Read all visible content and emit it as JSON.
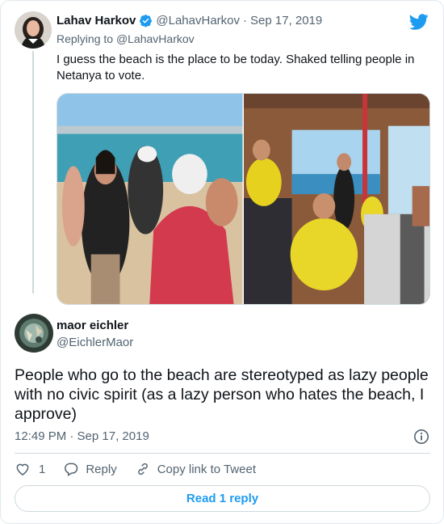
{
  "parent_tweet": {
    "name": "Lahav Harkov",
    "handle": "@LahavHarkov",
    "separator": "·",
    "date": "Sep 17, 2019",
    "replying_prefix": "Replying to",
    "replying_to": "@LahavHarkov",
    "text": "I guess the beach is the place to be today. Shaked telling people in Netanya to vote.",
    "verified": true
  },
  "reply_tweet": {
    "name": "maor eichler",
    "handle": "@EichlerMaor",
    "text": "People who go to the beach are stereotyped as lazy people with no civic spirit (as a lazy person who hates the beach, I approve)",
    "timestamp": "12:49 PM · Sep 17, 2019"
  },
  "actions": {
    "like_count": "1",
    "reply_label": "Reply",
    "copy_link_label": "Copy link to Tweet"
  },
  "read_replies_label": "Read 1 reply",
  "colors": {
    "brand_blue": "#1d9bf0",
    "text_primary": "#0f1419",
    "text_secondary": "#536471",
    "border": "#cfd9de"
  },
  "icons": [
    "twitter-bird-icon",
    "verified-badge-icon",
    "info-icon",
    "heart-icon",
    "reply-bubble-icon",
    "link-icon"
  ]
}
